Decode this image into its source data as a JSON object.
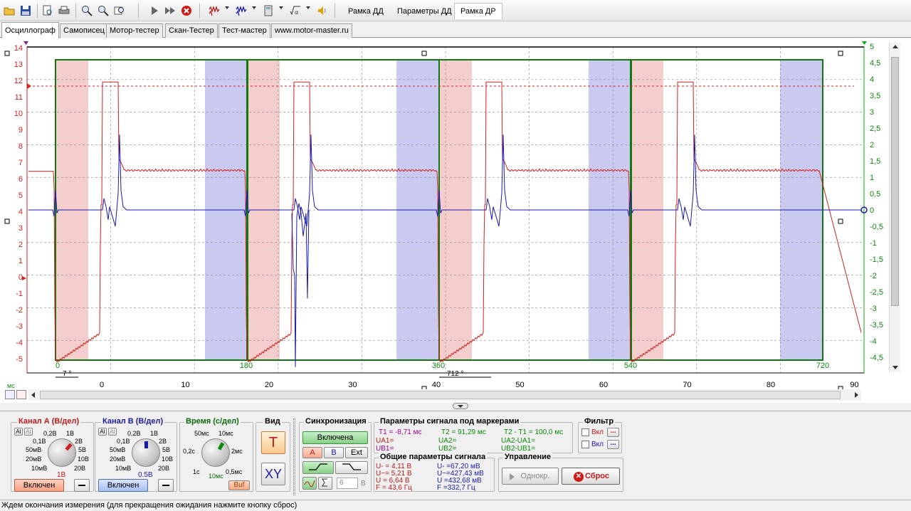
{
  "toolbar": {
    "tabs": [
      "Рамка ДД",
      "Параметры ДД",
      "Рамка ДР"
    ]
  },
  "mode_tabs": [
    "Осциллограф",
    "Самописец",
    "Мотор-тестер",
    "Скан-Тестер",
    "Тест-мастер",
    "www.motor-master.ru"
  ],
  "chart_data": {
    "type": "line",
    "left_axis": {
      "ticks": [
        "14",
        "13",
        "12",
        "11",
        "10",
        "9",
        "8",
        "7",
        "6",
        "5",
        "4",
        "3",
        "2",
        "1",
        "0",
        "-1",
        "-2",
        "-3",
        "-4",
        "-5"
      ]
    },
    "right_axis": {
      "ticks": [
        "5",
        "4,5",
        "4",
        "3,5",
        "3",
        "2,5",
        "2",
        "1,5",
        "1",
        "0,5",
        "0",
        "-0,5",
        "-1",
        "-1,5",
        "-2",
        "-2,5",
        "-3",
        "-3,5",
        "-4",
        "-4,5"
      ]
    },
    "x_axis": {
      "unit": "мс",
      "ticks": [
        "0",
        "10",
        "20",
        "30",
        "40",
        "50",
        "60",
        "70",
        "80",
        "90"
      ]
    },
    "degree_labels": [
      "0",
      "180",
      "360",
      "540",
      "720"
    ],
    "marker_labels": [
      "7 °",
      "712 °"
    ],
    "series": [
      {
        "channel": "A",
        "color": "#d42020",
        "baseline": 6.4,
        "points": [
          [
            -8,
            6.4
          ],
          [
            -6,
            6.4
          ],
          [
            -5.6,
            -2
          ],
          [
            -5.3,
            -5
          ],
          [
            0,
            -4.4
          ],
          [
            -2,
            -4.6
          ],
          [
            -1,
            -4.3
          ],
          [
            -0.5,
            -3.6
          ],
          [
            0,
            -3.4
          ],
          [
            0.4,
            11.8
          ],
          [
            2.1,
            11.8
          ],
          [
            2.3,
            6.5
          ],
          [
            20,
            6.4
          ]
        ]
      },
      {
        "channel": "B",
        "color": "#1a1aa8",
        "baseline": 0,
        "points": [
          [
            -8,
            0
          ],
          [
            -6,
            0
          ],
          [
            -5.5,
            0.5
          ],
          [
            -5.3,
            -0.2
          ],
          [
            0,
            0
          ],
          [
            0.5,
            0.4
          ],
          [
            1,
            0
          ],
          [
            1.8,
            -0.6
          ],
          [
            2.2,
            2.3
          ],
          [
            2.5,
            0.3
          ],
          [
            3,
            0
          ],
          [
            20,
            0
          ]
        ]
      }
    ]
  },
  "panels": {
    "ch_a": {
      "title": "Канал А (В/дел)",
      "scales": [
        "0,1В",
        "0,2В",
        "1В",
        "2В",
        "50мВ",
        "5В",
        "20мВ",
        "10В",
        "10мВ",
        "20В"
      ],
      "value": "1В",
      "state": "Включен",
      "ac1": "AI",
      "ac2": "AI"
    },
    "ch_b": {
      "title": "Канал В (В/дел)",
      "scales": [
        "0,1В",
        "0,2В",
        "1В",
        "2В",
        "50мВ",
        "5В",
        "20мВ",
        "10В",
        "10мВ",
        "20В"
      ],
      "value": "0.5В",
      "state": "Включен",
      "ac1": "AI",
      "ac2": "AI"
    },
    "time": {
      "title": "Время (с/дел)",
      "scales": [
        "50мс",
        "10мс",
        "0,2с",
        "2мс",
        "1с",
        "0,5мс",
        "10мс"
      ],
      "buf": "Buf"
    },
    "view": {
      "title": "Вид",
      "t": "T",
      "xy": "XY"
    },
    "sync": {
      "title": "Синхронизация",
      "state": "Включена",
      "a": "A",
      "b": "B",
      "ext": "Ext",
      "level": "6",
      "unit": "В"
    },
    "markers": {
      "title": "Параметры сигнала под маркерами",
      "t1": "T1 = -8,71 мс",
      "t2": "T2 = 91,29 мс",
      "dt": "T2 - T1 = 100,0 мс",
      "ua1": "UА1=",
      "ua2": "UА2=",
      "uadiff": "UА2-UА1=",
      "ub1": "UВ1=",
      "ub2": "UВ2=",
      "ubdiff": "UВ2-UВ1="
    },
    "general": {
      "title": "Общие параметры сигнала",
      "a": [
        "U- = 4,11 В",
        "U~= 5,21 В",
        "U  = 6,64 В",
        "F  = 43,6 Гц"
      ],
      "b": [
        "U- =67,20 мВ",
        "U~=427,43 мВ",
        "U =432,68 мВ",
        "F  =332,7 Гц"
      ]
    },
    "filter": {
      "title": "Фильтр",
      "items": [
        "Вкл",
        "Вкл"
      ],
      "dots": "..."
    },
    "control": {
      "title": "Управление",
      "single": "Однокр.",
      "reset": "Сброс"
    }
  },
  "status": "Ждем окончания измерения (для прекращения ожидания нажмите кнопку сброс)"
}
